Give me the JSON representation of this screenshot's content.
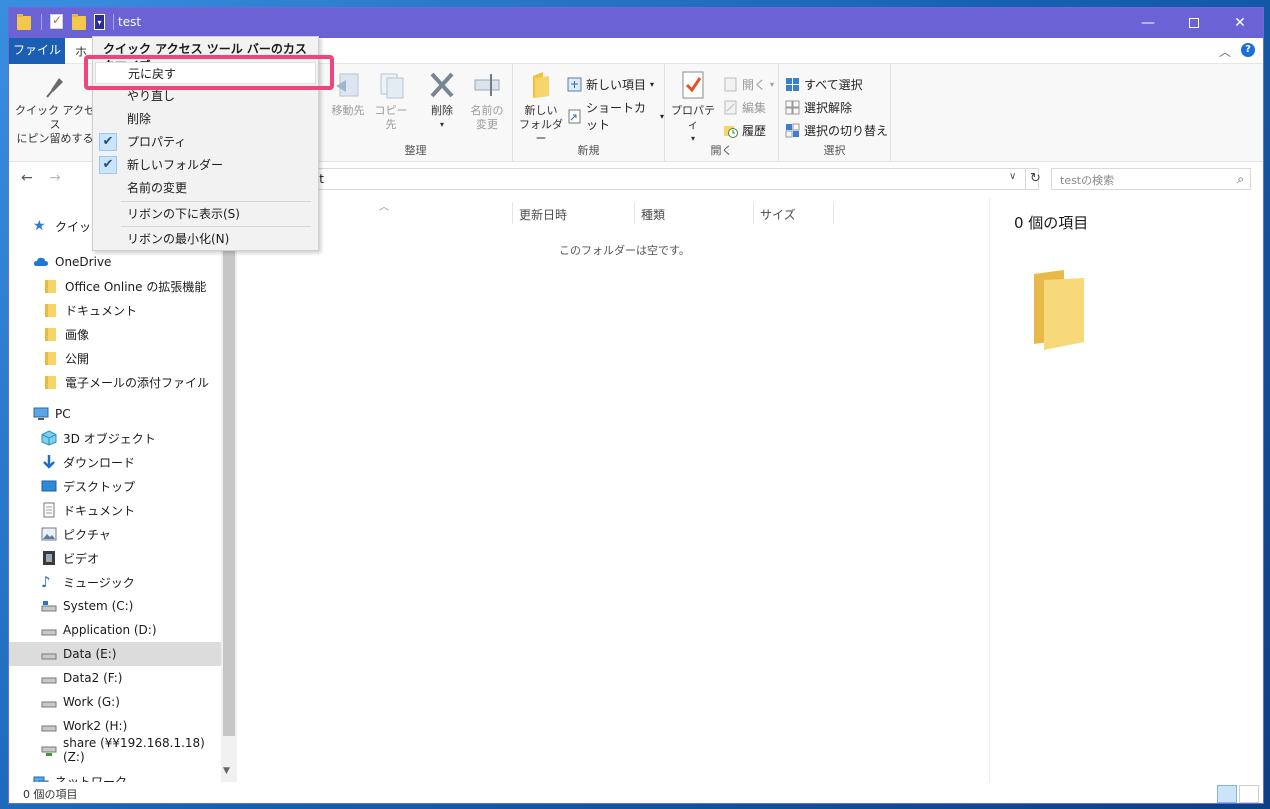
{
  "window": {
    "title": "test"
  },
  "colors": {
    "titlebar": "#6b62d6",
    "file_tab": "#1a5fb4",
    "highlight": "#f0457a",
    "folder": "#f2c94c"
  },
  "tabs": {
    "file": "ファイル",
    "home": "ホ"
  },
  "ribbon": {
    "pin": "クイック アクセス\nにピン留めする",
    "move_to": "移動先",
    "copy_to": "コピー先",
    "delete": "削除",
    "rename": "名前の\n変更",
    "new_folder": "新しい\nフォルダー",
    "new_item": "新しい項目",
    "shortcut": "ショートカット",
    "properties": "プロパティ",
    "open": "開く",
    "edit": "編集",
    "history": "履歴",
    "select_all": "すべて選択",
    "select_none": "選択解除",
    "invert_select": "選択の切り替え",
    "groups": {
      "organize": "整理",
      "new": "新規",
      "open": "開く",
      "select": "選択"
    }
  },
  "menu": {
    "title": "クイック アクセス ツール バーのカスタマイズ",
    "items": [
      {
        "label": "元に戻す",
        "checked": false
      },
      {
        "label": "やり直し",
        "checked": false
      },
      {
        "label": "削除",
        "checked": false
      },
      {
        "label": "プロパティ",
        "checked": true
      },
      {
        "label": "新しいフォルダー",
        "checked": true
      },
      {
        "label": "名前の変更",
        "checked": false
      },
      {
        "label": "リボンの下に表示(S)",
        "checked": false
      },
      {
        "label": "リボンの最小化(N)",
        "checked": false
      }
    ]
  },
  "address": {
    "path": "st",
    "search_placeholder": "testの検索"
  },
  "columns": [
    "更新日時",
    "種類",
    "サイズ"
  ],
  "empty_message": "このフォルダーは空です。",
  "sidebar": {
    "items": [
      {
        "label": "クイック",
        "icon": "star-icon"
      },
      {
        "label": "OneDrive",
        "icon": "cloud-icon"
      },
      {
        "label": "Office Online の拡張機能",
        "icon": "folder-icon"
      },
      {
        "label": "ドキュメント",
        "icon": "folder-icon"
      },
      {
        "label": "画像",
        "icon": "folder-icon"
      },
      {
        "label": "公開",
        "icon": "folder-icon"
      },
      {
        "label": "電子メールの添付ファイル",
        "icon": "folder-icon"
      },
      {
        "label": "PC",
        "icon": "pc-icon"
      },
      {
        "label": "3D オブジェクト",
        "icon": "cube-icon"
      },
      {
        "label": "ダウンロード",
        "icon": "download-icon"
      },
      {
        "label": "デスクトップ",
        "icon": "desktop-icon"
      },
      {
        "label": "ドキュメント",
        "icon": "document-icon"
      },
      {
        "label": "ピクチャ",
        "icon": "picture-icon"
      },
      {
        "label": "ビデオ",
        "icon": "video-icon"
      },
      {
        "label": "ミュージック",
        "icon": "music-icon"
      },
      {
        "label": "System (C:)",
        "icon": "drive-icon"
      },
      {
        "label": "Application (D:)",
        "icon": "drive-icon"
      },
      {
        "label": "Data (E:)",
        "icon": "drive-icon"
      },
      {
        "label": "Data2 (F:)",
        "icon": "drive-icon"
      },
      {
        "label": "Work (G:)",
        "icon": "drive-icon"
      },
      {
        "label": "Work2 (H:)",
        "icon": "drive-icon"
      },
      {
        "label": "share (¥¥192.168.1.18) (Z:)",
        "icon": "network-drive-icon"
      },
      {
        "label": "ネットワーク",
        "icon": "network-icon"
      }
    ]
  },
  "preview": {
    "title": "0 個の項目"
  },
  "status": {
    "text": "0 個の項目"
  }
}
